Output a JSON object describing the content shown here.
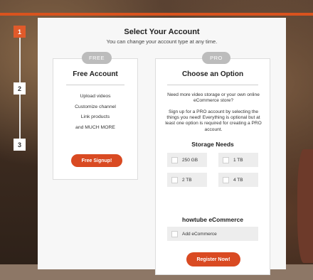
{
  "steps": [
    "1",
    "2",
    "3"
  ],
  "header": {
    "title": "Select Your Account",
    "subtitle": "You can change your account type at any time."
  },
  "free_card": {
    "badge": "FREE",
    "title": "Free Account",
    "features": [
      "Upload videos",
      "Customize channel",
      "Link products",
      "and MUCH MORE"
    ],
    "button": "Free Signup!"
  },
  "pro_card": {
    "badge": "PRO",
    "title": "Choose an Option",
    "desc1": "Need more video storage or your own online eCommerce store?",
    "desc2": "Sign up for a PRO account by selecting the things you need! Everything is optional but at least one option is required for creating a PRO account.",
    "storage_title": "Storage Needs",
    "storage_options": [
      "250 GB",
      "1 TB",
      "2 TB",
      "4 TB"
    ],
    "ecommerce_title": "howtube eCommerce",
    "ecommerce_option": "Add eCommerce",
    "button": "Register Now!"
  },
  "colors": {
    "accent": "#d94a22",
    "step_active": "#e15a2a",
    "badge": "#bcbcbc"
  }
}
